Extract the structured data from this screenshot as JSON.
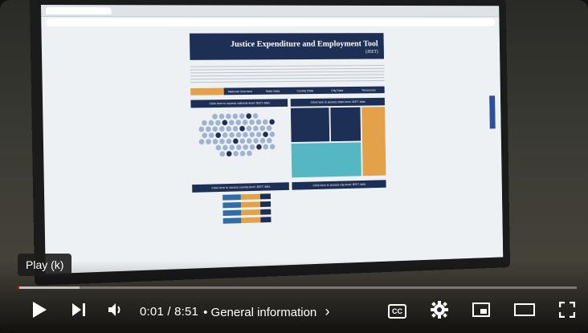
{
  "video": {
    "screen": {
      "site_title": "Justice Expenditure and Employment Tool",
      "site_subtitle": "(JEET)",
      "nav_items": [
        "",
        "National Overview",
        "State Data",
        "County Data",
        "City Data",
        "Resources"
      ],
      "panel_left_header": "Click here to access national-level JEET data",
      "panel_right_header": "Click here to access state-level JEET data",
      "panel_bottom_left_header": "Click here to access county-level JEET data",
      "panel_bottom_right_header": "Click here to access city-level JEET data"
    }
  },
  "tooltip": {
    "text": "Play (k)"
  },
  "progress": {
    "played_fraction": 0.001,
    "loaded_fraction": 0.11
  },
  "controls": {
    "time_current": "0:01",
    "time_separator": " / ",
    "time_total": "8:51",
    "chapter_separator": " • ",
    "chapter_title": "General information",
    "chapter_chevron": "›",
    "cc_label": "CC"
  },
  "icons": {
    "play": "play-icon",
    "next": "next-icon",
    "volume": "volume-icon",
    "settings": "gear-icon",
    "miniplayer": "miniplayer-icon",
    "theater": "theater-mode-icon",
    "fullscreen": "fullscreen-icon"
  },
  "colors": {
    "progress_played": "#ff0000",
    "accent_navy": "#1e2f55",
    "accent_orange": "#e3a24a"
  }
}
